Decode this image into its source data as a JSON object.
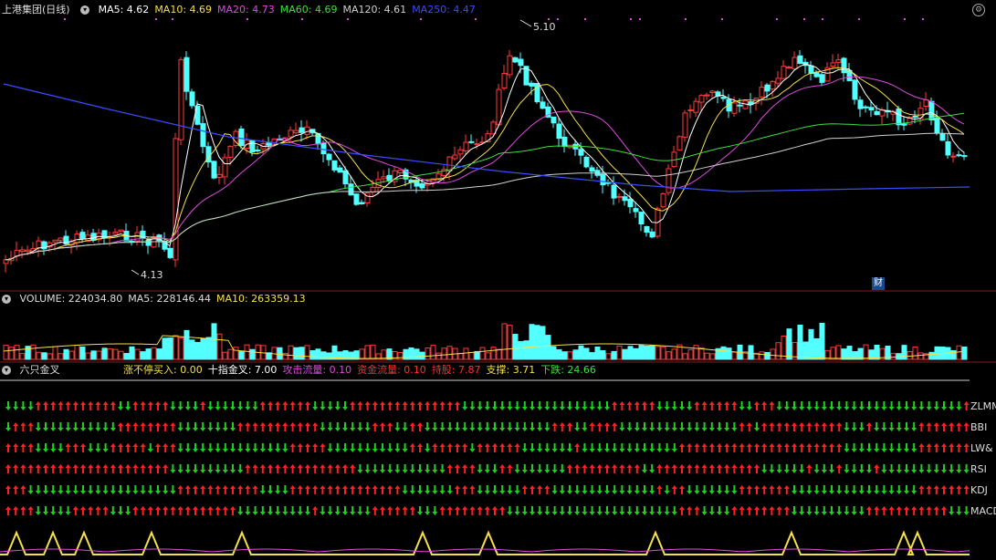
{
  "main_panel": {
    "title": "上港集团(日线)",
    "ma_legend": [
      {
        "label": "MA5: 4.62",
        "color": "#ffffff"
      },
      {
        "label": "MA10: 4.69",
        "color": "#f5e04a"
      },
      {
        "label": "MA20: 4.73",
        "color": "#e04ae0"
      },
      {
        "label": "MA60: 4.69",
        "color": "#3ee03e"
      },
      {
        "label": "MA120: 4.61",
        "color": "#d0d0d0"
      },
      {
        "label": "MA250: 4.47",
        "color": "#3a4cff"
      }
    ],
    "high_label": "5.10",
    "low_label": "4.13",
    "fin_badge": "财",
    "settings_icon": "config-icon"
  },
  "volume_panel": {
    "legend": [
      {
        "label": "VOLUME: 224034.80",
        "color": "#dddddd"
      },
      {
        "label": "MA5: 228146.44",
        "color": "#dddddd"
      },
      {
        "label": "MA10: 263359.13",
        "color": "#f5e04a"
      }
    ]
  },
  "indicator_panel": {
    "title": "六只金叉",
    "legend": [
      {
        "label": "涨不停买入: 0.00",
        "color": "#f5e04a"
      },
      {
        "label": "十指金叉: 7.00",
        "color": "#ffffff"
      },
      {
        "label": "攻击流量: 0.10",
        "color": "#e04ae0"
      },
      {
        "label": "资金流量: 0.10",
        "color": "#ff3030"
      },
      {
        "label": "持股: 7.87",
        "color": "#ff3030"
      },
      {
        "label": "支撑: 3.71",
        "color": "#f5e04a"
      },
      {
        "label": "下跌: 24.66",
        "color": "#3ee03e"
      }
    ],
    "rows": [
      {
        "label": "ZLMM"
      },
      {
        "label": "BBI"
      },
      {
        "label": "LW&"
      },
      {
        "label": "RSI"
      },
      {
        "label": "KDJ"
      },
      {
        "label": "MACD"
      }
    ],
    "colors": {
      "up": "#ff2020",
      "down": "#20d020"
    }
  }
}
